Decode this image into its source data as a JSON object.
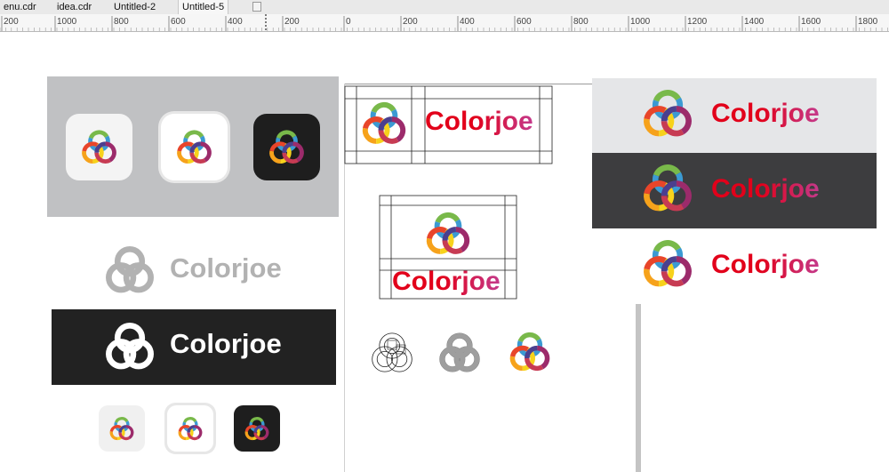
{
  "tabs": [
    {
      "label": "enu.cdr",
      "active": false
    },
    {
      "label": "idea.cdr",
      "active": false
    },
    {
      "label": "Untitled-2",
      "active": false
    },
    {
      "label": "Untitled-5",
      "active": true
    }
  ],
  "ruler": {
    "ticks": [
      "200",
      "1000",
      "800",
      "600",
      "400",
      "200",
      "0",
      "200",
      "400",
      "600",
      "800",
      "1000",
      "1200",
      "1400",
      "1600",
      "1800"
    ]
  },
  "brand": {
    "name": "Colorjoe",
    "red": "#e2001a",
    "magenta": "#c43a8c",
    "gray": "#b2b2b2",
    "dark": "#222222",
    "dark_panel": "#3d3d3f",
    "light_panel": "#e5e6e8",
    "icon_panel": "#c0c1c3"
  },
  "icons": {
    "logo": "colorjoe-rings-icon",
    "new_tab": "new-tab-icon"
  }
}
